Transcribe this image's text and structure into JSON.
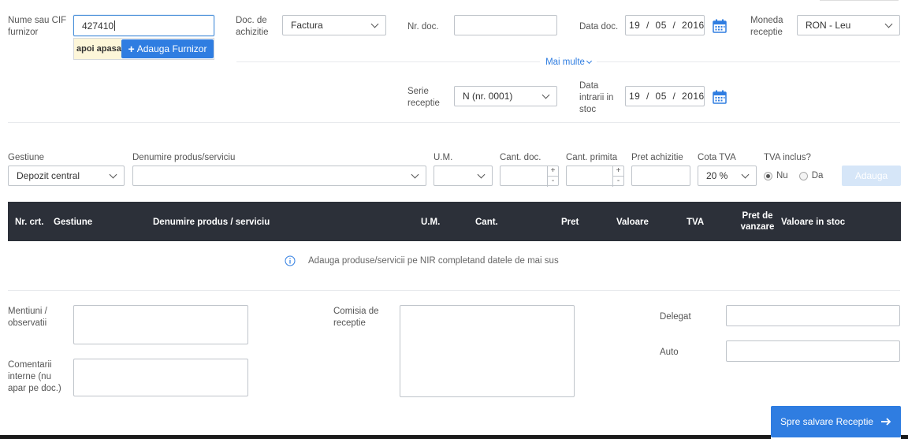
{
  "header": {
    "supplier": {
      "label": "Nume sau CIF furnizor",
      "value": "427410",
      "hint": "apoi apasa",
      "add_button": "Adauga Furnizor"
    },
    "doc_type": {
      "label": "Doc. de achizitie",
      "value": "Factura"
    },
    "doc_no": {
      "label": "Nr. doc.",
      "value": ""
    },
    "doc_date": {
      "label": "Data doc.",
      "value": "19  /  05  /  2016"
    },
    "currency": {
      "label": "Moneda receptie",
      "value": "RON - Leu"
    },
    "more_link": "Mai multe",
    "series": {
      "label": "Serie receptie",
      "value": "N (nr. 0001)"
    },
    "stock_date": {
      "label": "Data intrarii in stoc",
      "value": "19  /  05  /  2016"
    }
  },
  "item_form": {
    "gestiune": {
      "label": "Gestiune",
      "value": "Depozit central"
    },
    "product": {
      "label": "Denumire produs/serviciu",
      "value": ""
    },
    "um": {
      "label": "U.M.",
      "value": ""
    },
    "qty_doc": {
      "label": "Cant. doc.",
      "value": ""
    },
    "qty_received": {
      "label": "Cant. primita",
      "value": ""
    },
    "price": {
      "label": "Pret achizitie",
      "value": ""
    },
    "vat_rate": {
      "label": "Cota TVA",
      "value": "20 %"
    },
    "vat_included": {
      "label": "TVA inclus?",
      "options": [
        "Nu",
        "Da"
      ],
      "selected": "Nu"
    },
    "add_button": "Adauga",
    "stepper_plus": "+",
    "stepper_minus": "-"
  },
  "table": {
    "columns": [
      "Nr. crt.",
      "Gestiune",
      "Denumire produs / serviciu",
      "U.M.",
      "Cant.",
      "Pret",
      "Valoare",
      "TVA",
      "Pret de vanzare",
      "Valoare in stoc"
    ],
    "empty_message": "Adauga produse/servicii pe NIR completand datele de mai sus"
  },
  "footer": {
    "mentions_label": "Mentiuni / observatii",
    "internal_label": "Comentarii interne (nu apar pe doc.)",
    "commission_label": "Comisia de receptie",
    "delegate_label": "Delegat",
    "auto_label": "Auto",
    "save_button": "Spre salvare Receptie"
  },
  "colors": {
    "primary": "#2f7de1",
    "header_dark": "#2c3039",
    "link": "#2f7de1",
    "disabled": "#d6e6f8"
  }
}
